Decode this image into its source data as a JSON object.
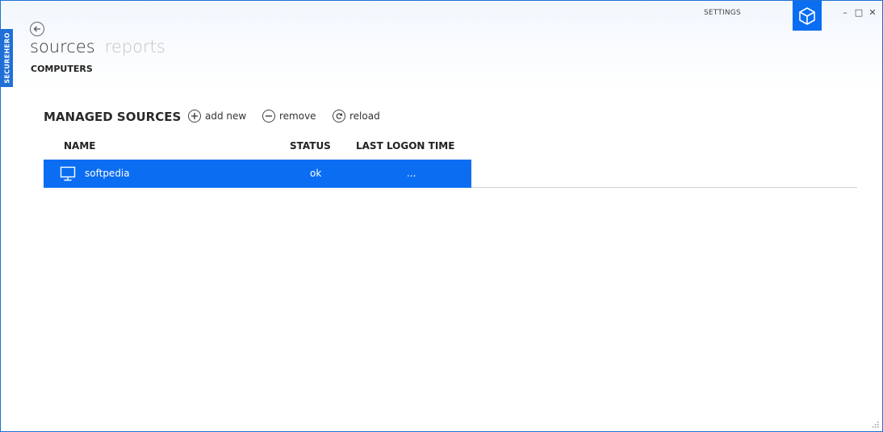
{
  "app": {
    "side_label": "SECUREHERO",
    "settings_label": "SETTINGS",
    "window_controls": {
      "minimize": "–",
      "maximize": "□",
      "close": "✕"
    }
  },
  "nav": {
    "tabs": [
      {
        "label": "sources",
        "active": true
      },
      {
        "label": "reports",
        "active": false
      }
    ],
    "sub_label": "COMPUTERS"
  },
  "section": {
    "title": "MANAGED SOURCES",
    "actions": {
      "add_new": "add new",
      "remove": "remove",
      "reload": "reload"
    }
  },
  "table": {
    "columns": [
      "NAME",
      "STATUS",
      "LAST LOGON TIME"
    ],
    "rows": [
      {
        "name": "softpedia",
        "status": "ok",
        "last_logon": "...",
        "icon": "monitor-icon",
        "selected": true
      }
    ]
  },
  "colors": {
    "accent": "#0b6ef2",
    "border": "#1f6fd6",
    "inactive_tab": "#c3c3c3"
  }
}
